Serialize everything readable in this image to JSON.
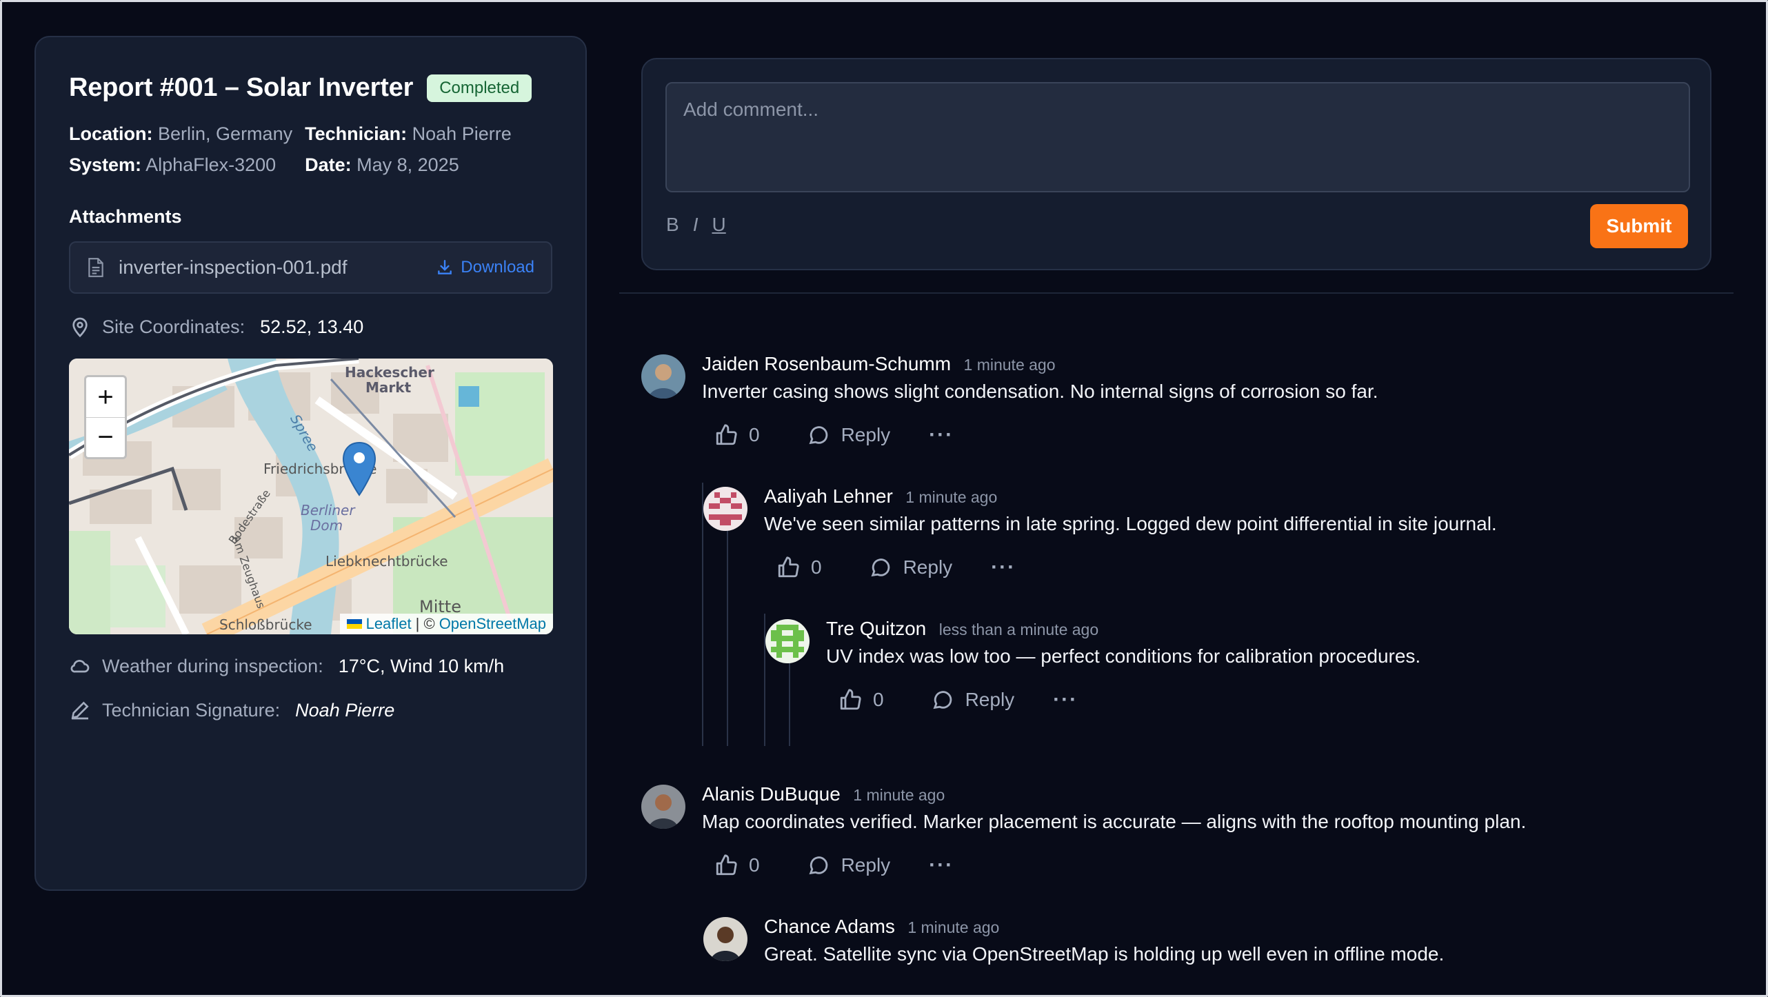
{
  "report": {
    "title": "Report #001 – Solar Inverter",
    "status": "Completed",
    "location_label": "Location:",
    "location_value": "Berlin, Germany",
    "technician_label": "Technician:",
    "technician_value": "Noah Pierre",
    "system_label": "System:",
    "system_value": "AlphaFlex-3200",
    "date_label": "Date:",
    "date_value": "May 8, 2025",
    "attachments_heading": "Attachments",
    "attachment_name": "inverter-inspection-001.pdf",
    "download_label": "Download",
    "coordinates_label": "Site Coordinates:",
    "coordinates_value": "52.52, 13.40",
    "weather_label": "Weather during inspection:",
    "weather_value": "17°C, Wind 10 km/h",
    "signature_label": "Technician Signature:",
    "signature_value": "Noah Pierre"
  },
  "map": {
    "zoom_in": "+",
    "zoom_out": "−",
    "attribution_leaflet": "Leaflet",
    "attribution_sep": "| ©",
    "attribution_osm": "OpenStreetMap",
    "labels": {
      "hackescher": "Hackescher",
      "markt": "Markt",
      "friedrichs": "Friedrichsbrücke",
      "berliner": "Berliner",
      "dom": "Dom",
      "liebknecht": "Liebknechtbrücke",
      "bodestrasse": "Bodestraße",
      "zeughaus": "Am Zeughaus",
      "schloss": "Schloßbrücke",
      "mitte": "Mitte",
      "spree": "Spree"
    }
  },
  "composer": {
    "placeholder": "Add comment...",
    "bold": "B",
    "italic": "I",
    "underline": "U",
    "submit": "Submit"
  },
  "comments": [
    {
      "author": "Jaiden Rosenbaum-Schumm",
      "time": "1 minute ago",
      "text": "Inverter casing shows slight condensation. No internal signs of corrosion so far.",
      "likes": "0",
      "reply": "Reply",
      "more": "···"
    },
    {
      "author": "Aaliyah Lehner",
      "time": "1 minute ago",
      "text": "We've seen similar patterns in late spring. Logged dew point differential in site journal.",
      "likes": "0",
      "reply": "Reply",
      "more": "···"
    },
    {
      "author": "Tre Quitzon",
      "time": "less than a minute ago",
      "text": "UV index was low too — perfect conditions for calibration procedures.",
      "likes": "0",
      "reply": "Reply",
      "more": "···"
    },
    {
      "author": "Alanis DuBuque",
      "time": "1 minute ago",
      "text": "Map coordinates verified. Marker placement is accurate — aligns with the rooftop mounting plan.",
      "likes": "0",
      "reply": "Reply",
      "more": "···"
    },
    {
      "author": "Chance Adams",
      "time": "1 minute ago",
      "text": "Great. Satellite sync via OpenStreetMap is holding up well even in offline mode."
    }
  ]
}
